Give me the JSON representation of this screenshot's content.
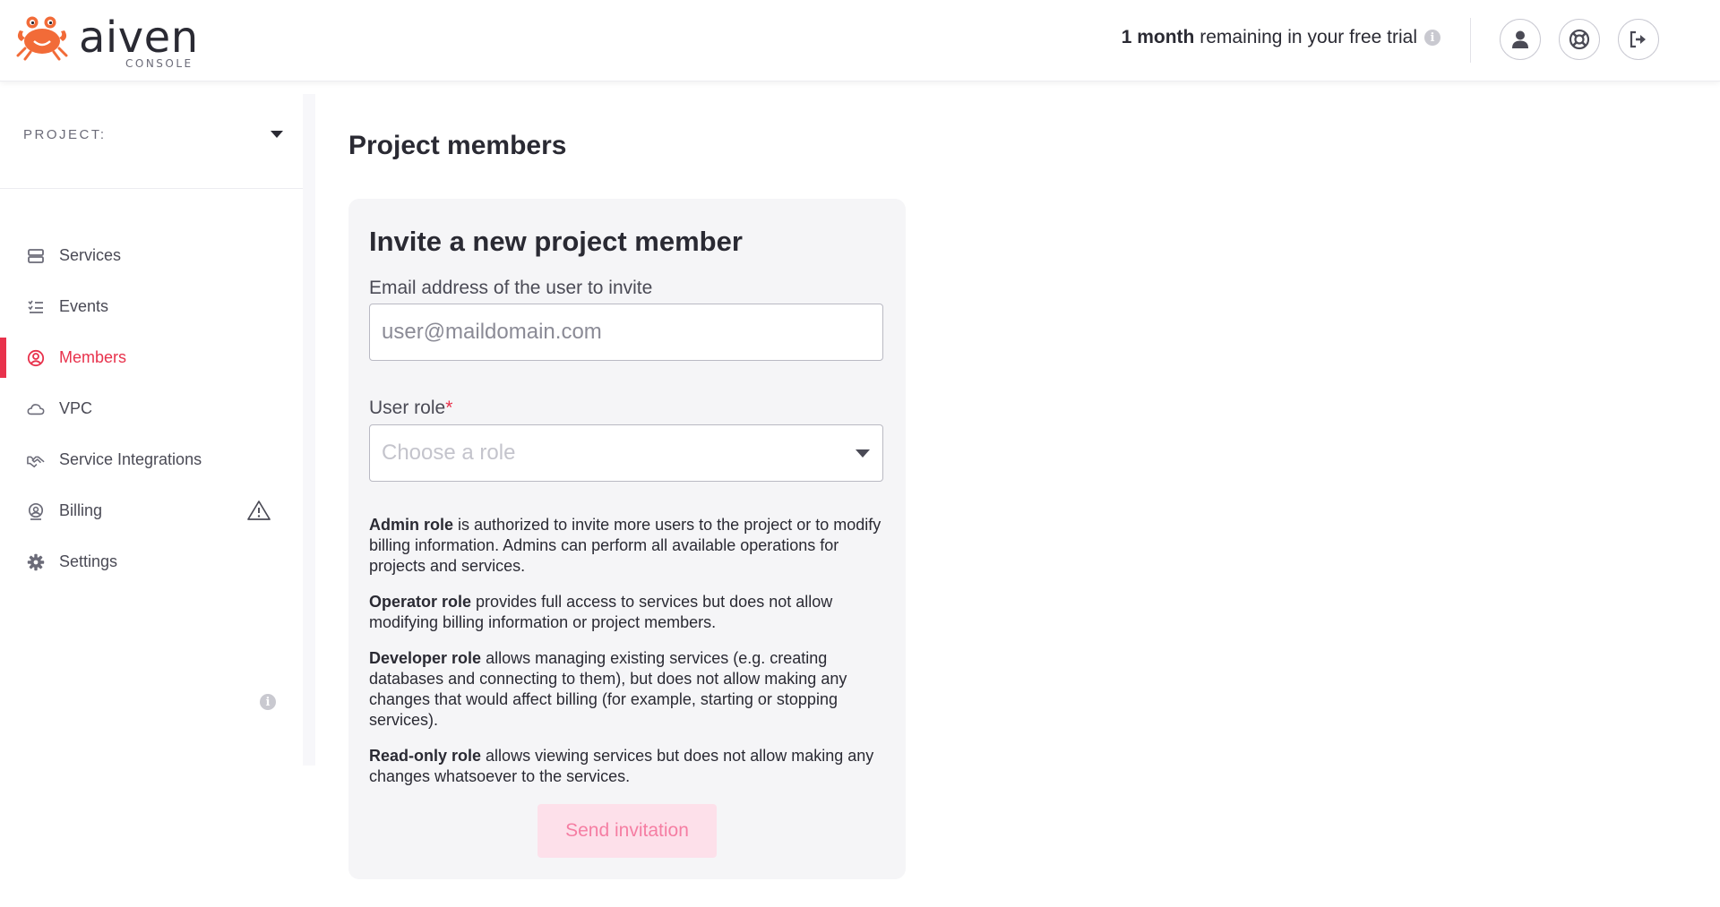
{
  "header": {
    "brand": "aiven",
    "brand_sub": "CONSOLE",
    "trial_bold": "1 month",
    "trial_rest": "remaining in your free trial",
    "trial_info_icon": "info-icon",
    "buttons": [
      {
        "name": "profile-button",
        "icon": "user-icon"
      },
      {
        "name": "support-button",
        "icon": "lifebuoy-icon"
      },
      {
        "name": "logout-button",
        "icon": "logout-icon"
      }
    ]
  },
  "sidebar": {
    "project_label": "PROJECT:",
    "items": [
      {
        "label": "Services",
        "icon": "services-icon",
        "active": false
      },
      {
        "label": "Events",
        "icon": "events-icon",
        "active": false
      },
      {
        "label": "Members",
        "icon": "members-icon",
        "active": true
      },
      {
        "label": "VPC",
        "icon": "cloud-icon",
        "active": false
      },
      {
        "label": "Service Integrations",
        "icon": "handshake-icon",
        "active": false
      },
      {
        "label": "Billing",
        "icon": "billing-icon",
        "active": false,
        "warning": true
      },
      {
        "label": "Settings",
        "icon": "gear-icon",
        "active": false
      }
    ]
  },
  "main": {
    "page_title": "Project members",
    "card": {
      "title": "Invite a new project member",
      "email_label": "Email address of the user to invite",
      "email_placeholder": "user@maildomain.com",
      "email_value": "",
      "role_label": "User role",
      "role_required_mark": "*",
      "role_placeholder": "Choose a role",
      "roles": [
        {
          "name": "Admin role",
          "desc": "is authorized to invite more users to the project or to modify billing information. Admins can perform all available operations for projects and services."
        },
        {
          "name": "Operator role",
          "desc": "provides full access to services but does not allow modifying billing information or project members."
        },
        {
          "name": "Developer role",
          "desc": "allows managing existing services (e.g. creating databases and connecting to them), but does not allow making any changes that would affect billing (for example, starting or stopping services)."
        },
        {
          "name": "Read-only role",
          "desc": "allows viewing services but does not allow making any changes whatsoever to the services."
        }
      ],
      "send_button": "Send invitation"
    }
  },
  "colors": {
    "accent": "#e8324c",
    "brand_orange": "#f26b38",
    "card_bg": "#f5f5f7",
    "button_disabled_bg": "#fde0ea",
    "button_disabled_text": "#f57ea3"
  }
}
